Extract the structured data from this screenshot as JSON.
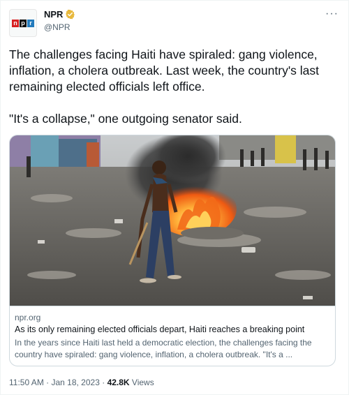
{
  "author": {
    "name": "NPR",
    "handle": "@NPR",
    "logo_letters": [
      "n",
      "p",
      "r"
    ],
    "logo_colors": [
      "#d62021",
      "#000000",
      "#237bbd"
    ],
    "verified_color": "#e8b93e"
  },
  "tweet": {
    "paragraphs": [
      "The challenges facing Haiti have spiraled: gang violence, inflation, a cholera outbreak. Last week, the country's last remaining elected officials left office.",
      "\"It's a collapse,\" one outgoing senator said."
    ]
  },
  "card": {
    "domain": "npr.org",
    "title": "As its only remaining elected officials depart, Haiti reaches a breaking point",
    "description": "In the years since Haiti last held a democratic election, the challenges facing the country have spiraled: gang violence, inflation, a cholera outbreak. \"It's a ..."
  },
  "meta": {
    "time": "11:50 AM",
    "separator": " · ",
    "date": "Jan 18, 2023",
    "separator2": " · ",
    "views": "42.8K",
    "views_label": " Views"
  },
  "icons": {
    "more": "more-options-icon",
    "verified": "verified-badge-icon"
  }
}
